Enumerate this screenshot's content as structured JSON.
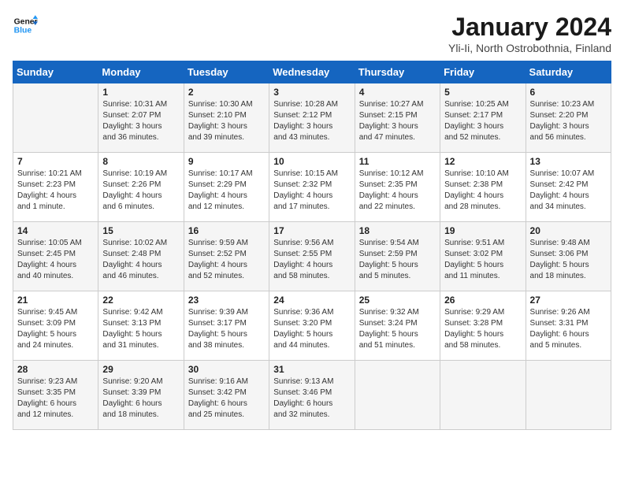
{
  "header": {
    "logo_line1": "General",
    "logo_line2": "Blue",
    "title": "January 2024",
    "subtitle": "Yli-Ii, North Ostrobothnia, Finland"
  },
  "weekdays": [
    "Sunday",
    "Monday",
    "Tuesday",
    "Wednesday",
    "Thursday",
    "Friday",
    "Saturday"
  ],
  "weeks": [
    [
      {
        "day": null,
        "info": null
      },
      {
        "day": "1",
        "info": "Sunrise: 10:31 AM\nSunset: 2:07 PM\nDaylight: 3 hours\nand 36 minutes."
      },
      {
        "day": "2",
        "info": "Sunrise: 10:30 AM\nSunset: 2:10 PM\nDaylight: 3 hours\nand 39 minutes."
      },
      {
        "day": "3",
        "info": "Sunrise: 10:28 AM\nSunset: 2:12 PM\nDaylight: 3 hours\nand 43 minutes."
      },
      {
        "day": "4",
        "info": "Sunrise: 10:27 AM\nSunset: 2:15 PM\nDaylight: 3 hours\nand 47 minutes."
      },
      {
        "day": "5",
        "info": "Sunrise: 10:25 AM\nSunset: 2:17 PM\nDaylight: 3 hours\nand 52 minutes."
      },
      {
        "day": "6",
        "info": "Sunrise: 10:23 AM\nSunset: 2:20 PM\nDaylight: 3 hours\nand 56 minutes."
      }
    ],
    [
      {
        "day": "7",
        "info": "Sunrise: 10:21 AM\nSunset: 2:23 PM\nDaylight: 4 hours\nand 1 minute."
      },
      {
        "day": "8",
        "info": "Sunrise: 10:19 AM\nSunset: 2:26 PM\nDaylight: 4 hours\nand 6 minutes."
      },
      {
        "day": "9",
        "info": "Sunrise: 10:17 AM\nSunset: 2:29 PM\nDaylight: 4 hours\nand 12 minutes."
      },
      {
        "day": "10",
        "info": "Sunrise: 10:15 AM\nSunset: 2:32 PM\nDaylight: 4 hours\nand 17 minutes."
      },
      {
        "day": "11",
        "info": "Sunrise: 10:12 AM\nSunset: 2:35 PM\nDaylight: 4 hours\nand 22 minutes."
      },
      {
        "day": "12",
        "info": "Sunrise: 10:10 AM\nSunset: 2:38 PM\nDaylight: 4 hours\nand 28 minutes."
      },
      {
        "day": "13",
        "info": "Sunrise: 10:07 AM\nSunset: 2:42 PM\nDaylight: 4 hours\nand 34 minutes."
      }
    ],
    [
      {
        "day": "14",
        "info": "Sunrise: 10:05 AM\nSunset: 2:45 PM\nDaylight: 4 hours\nand 40 minutes."
      },
      {
        "day": "15",
        "info": "Sunrise: 10:02 AM\nSunset: 2:48 PM\nDaylight: 4 hours\nand 46 minutes."
      },
      {
        "day": "16",
        "info": "Sunrise: 9:59 AM\nSunset: 2:52 PM\nDaylight: 4 hours\nand 52 minutes."
      },
      {
        "day": "17",
        "info": "Sunrise: 9:56 AM\nSunset: 2:55 PM\nDaylight: 4 hours\nand 58 minutes."
      },
      {
        "day": "18",
        "info": "Sunrise: 9:54 AM\nSunset: 2:59 PM\nDaylight: 5 hours\nand 5 minutes."
      },
      {
        "day": "19",
        "info": "Sunrise: 9:51 AM\nSunset: 3:02 PM\nDaylight: 5 hours\nand 11 minutes."
      },
      {
        "day": "20",
        "info": "Sunrise: 9:48 AM\nSunset: 3:06 PM\nDaylight: 5 hours\nand 18 minutes."
      }
    ],
    [
      {
        "day": "21",
        "info": "Sunrise: 9:45 AM\nSunset: 3:09 PM\nDaylight: 5 hours\nand 24 minutes."
      },
      {
        "day": "22",
        "info": "Sunrise: 9:42 AM\nSunset: 3:13 PM\nDaylight: 5 hours\nand 31 minutes."
      },
      {
        "day": "23",
        "info": "Sunrise: 9:39 AM\nSunset: 3:17 PM\nDaylight: 5 hours\nand 38 minutes."
      },
      {
        "day": "24",
        "info": "Sunrise: 9:36 AM\nSunset: 3:20 PM\nDaylight: 5 hours\nand 44 minutes."
      },
      {
        "day": "25",
        "info": "Sunrise: 9:32 AM\nSunset: 3:24 PM\nDaylight: 5 hours\nand 51 minutes."
      },
      {
        "day": "26",
        "info": "Sunrise: 9:29 AM\nSunset: 3:28 PM\nDaylight: 5 hours\nand 58 minutes."
      },
      {
        "day": "27",
        "info": "Sunrise: 9:26 AM\nSunset: 3:31 PM\nDaylight: 6 hours\nand 5 minutes."
      }
    ],
    [
      {
        "day": "28",
        "info": "Sunrise: 9:23 AM\nSunset: 3:35 PM\nDaylight: 6 hours\nand 12 minutes."
      },
      {
        "day": "29",
        "info": "Sunrise: 9:20 AM\nSunset: 3:39 PM\nDaylight: 6 hours\nand 18 minutes."
      },
      {
        "day": "30",
        "info": "Sunrise: 9:16 AM\nSunset: 3:42 PM\nDaylight: 6 hours\nand 25 minutes."
      },
      {
        "day": "31",
        "info": "Sunrise: 9:13 AM\nSunset: 3:46 PM\nDaylight: 6 hours\nand 32 minutes."
      },
      {
        "day": null,
        "info": null
      },
      {
        "day": null,
        "info": null
      },
      {
        "day": null,
        "info": null
      }
    ]
  ]
}
